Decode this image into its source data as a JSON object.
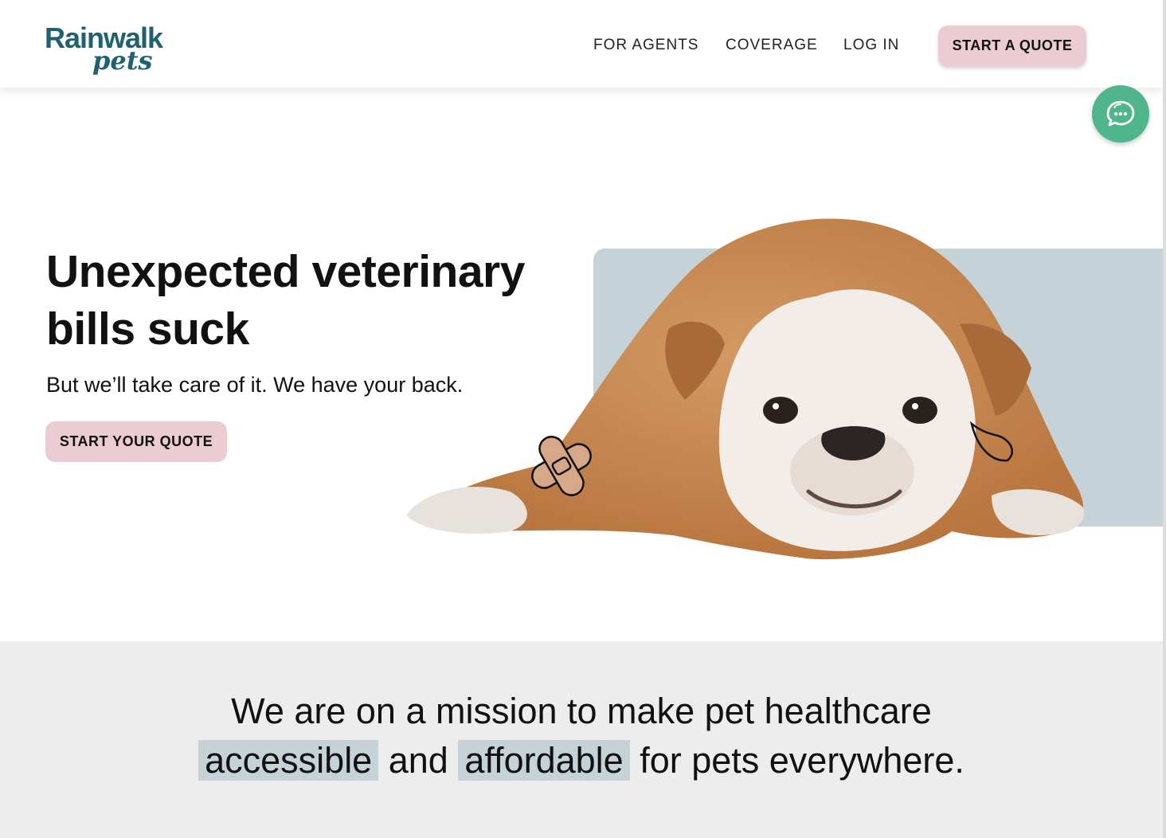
{
  "brand": {
    "logo_top": "Rainwalk",
    "logo_bottom": "pets"
  },
  "nav": {
    "agents": "FOR AGENTS",
    "coverage": "COVERAGE",
    "login": "LOG IN",
    "cta": "START A QUOTE"
  },
  "hero": {
    "title": "Unexpected veterinary bills suck",
    "subtitle": "But we’ll take care of it. We have your back.",
    "cta": "START YOUR QUOTE"
  },
  "mission": {
    "part1": "We are on a mission to make pet healthcare",
    "highlight1": "accessible",
    "part2": "and",
    "highlight2": "affordable",
    "part3": "for pets everywhere."
  },
  "icons": {
    "chat": "chat-bubbles-icon",
    "bandage": "bandage-icon",
    "tear": "tear-drop-icon"
  },
  "colors": {
    "brand": "#1f6170",
    "cta": "#ecccd3",
    "chat": "#4eb58c",
    "panel": "#c5d3d9",
    "mission_bg": "#ededed"
  }
}
